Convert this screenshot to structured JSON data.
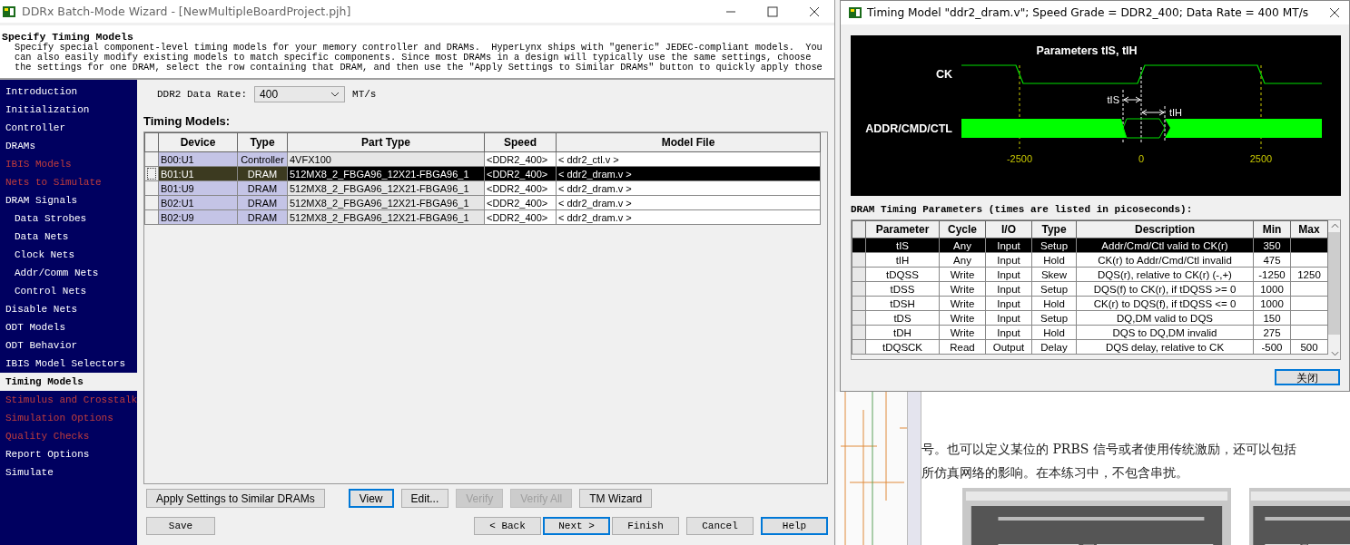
{
  "main_window": {
    "title": "DDRx Batch-Mode Wizard - [NewMultipleBoardProject.pjh]"
  },
  "header": {
    "title": "Specify Timing Models",
    "description": "Specify special component-level timing models for your memory controller and DRAMs.  HyperLynx ships with \"generic\" JEDEC-compliant models.  You can also easily modify existing models to match specific components. Since most DRAMs in a design will typically use the same settings, choose the settings for one DRAM, select the row containing that DRAM, and then use the \"Apply Settings to Similar DRAMs\" button to quickly apply those"
  },
  "sidebar": {
    "items": [
      {
        "label": "Introduction",
        "selected": false,
        "disabled": false
      },
      {
        "label": "Initialization",
        "selected": false,
        "disabled": false
      },
      {
        "label": "Controller",
        "selected": false,
        "disabled": false
      },
      {
        "label": "DRAMs",
        "selected": false,
        "disabled": false
      },
      {
        "label": "IBIS Models",
        "selected": false,
        "disabled": true
      },
      {
        "label": "Nets to Simulate",
        "selected": false,
        "disabled": true
      },
      {
        "label": "DRAM Signals",
        "selected": false,
        "disabled": false,
        "children": [
          {
            "label": "Data Strobes",
            "selected": false,
            "disabled": false
          },
          {
            "label": "Data Nets",
            "selected": false,
            "disabled": false
          },
          {
            "label": "Clock Nets",
            "selected": false,
            "disabled": false
          },
          {
            "label": "Addr/Comm Nets",
            "selected": false,
            "disabled": false
          },
          {
            "label": "Control Nets",
            "selected": false,
            "disabled": false
          }
        ]
      },
      {
        "label": "Disable Nets",
        "selected": false,
        "disabled": false
      },
      {
        "label": "ODT Models",
        "selected": false,
        "disabled": false
      },
      {
        "label": "ODT Behavior",
        "selected": false,
        "disabled": false
      },
      {
        "label": "IBIS Model Selectors",
        "selected": false,
        "disabled": false
      },
      {
        "label": "Timing Models",
        "selected": true,
        "disabled": false
      },
      {
        "label": "Stimulus and Crosstalk",
        "selected": false,
        "disabled": true
      },
      {
        "label": "Simulation Options",
        "selected": false,
        "disabled": true
      },
      {
        "label": "Quality Checks",
        "selected": false,
        "disabled": true
      },
      {
        "label": "Report Options",
        "selected": false,
        "disabled": false
      },
      {
        "label": "Simulate",
        "selected": false,
        "disabled": false
      }
    ]
  },
  "data_rate": {
    "label": "DDR2 Data Rate:",
    "value": "400",
    "unit": "MT/s"
  },
  "timing_models": {
    "heading": "Timing Models:",
    "columns": [
      "Device",
      "Type",
      "Part Type",
      "Speed",
      "Model File"
    ],
    "rows": [
      {
        "selected": false,
        "cells": [
          "B00:U1",
          "Controller",
          "4VFX100",
          "<DDR2_400>",
          "< ddr2_ctl.v >"
        ]
      },
      {
        "selected": true,
        "cells": [
          "B01:U1",
          "DRAM",
          "512MX8_2_FBGA96_12X21-FBGA96_1",
          "<DDR2_400>",
          "< ddr2_dram.v >"
        ]
      },
      {
        "selected": false,
        "cells": [
          "B01:U9",
          "DRAM",
          "512MX8_2_FBGA96_12X21-FBGA96_1",
          "<DDR2_400>",
          "< ddr2_dram.v >"
        ]
      },
      {
        "selected": false,
        "cells": [
          "B02:U1",
          "DRAM",
          "512MX8_2_FBGA96_12X21-FBGA96_1",
          "<DDR2_400>",
          "< ddr2_dram.v >"
        ]
      },
      {
        "selected": false,
        "cells": [
          "B02:U9",
          "DRAM",
          "512MX8_2_FBGA96_12X21-FBGA96_1",
          "<DDR2_400>",
          "< ddr2_dram.v >"
        ]
      }
    ]
  },
  "action_buttons": [
    {
      "label": "Apply Settings to Similar DRAMs",
      "disabled": false,
      "focused": false
    },
    {
      "label": "View",
      "disabled": false,
      "focused": true
    },
    {
      "label": "Edit...",
      "disabled": false,
      "focused": false
    },
    {
      "label": "Verify",
      "disabled": true,
      "focused": false
    },
    {
      "label": "Verify All",
      "disabled": true,
      "focused": false
    },
    {
      "label": "TM Wizard",
      "disabled": false,
      "focused": false
    }
  ],
  "nav_buttons": [
    {
      "label": "Save",
      "focused": false
    },
    {
      "label": "< Back",
      "focused": false
    },
    {
      "label": "Next >",
      "focused": true
    },
    {
      "label": "Finish",
      "focused": false
    },
    {
      "label": "Cancel",
      "focused": false
    },
    {
      "label": "Help",
      "focused": true
    }
  ],
  "dialog": {
    "title": "Timing Model \"ddr2_dram.v\";  Speed Grade = DDR2_400;  Data Rate = 400 MT/s",
    "diagram": {
      "title": "Parameters tIS, tIH",
      "signals": [
        "CK",
        "ADDR/CMD/CTL"
      ],
      "ticks": [
        "-2500",
        "0",
        "2500"
      ],
      "markers": [
        "tIS",
        "tIH"
      ]
    },
    "parameters": {
      "heading": "DRAM Timing Parameters (times are listed in picoseconds):",
      "columns": [
        "Parameter",
        "Cycle",
        "I/O",
        "Type",
        "Description",
        "Min",
        "Max"
      ],
      "rows": [
        {
          "selected": true,
          "cells": [
            "tIS",
            "Any",
            "Input",
            "Setup",
            "Addr/Cmd/Ctl valid to CK(r)",
            "350",
            ""
          ]
        },
        {
          "selected": false,
          "cells": [
            "tIH",
            "Any",
            "Input",
            "Hold",
            "CK(r) to Addr/Cmd/Ctl invalid",
            "475",
            ""
          ]
        },
        {
          "selected": false,
          "cells": [
            "tDQSS",
            "Write",
            "Input",
            "Skew",
            "DQS(r), relative to CK(r) (-,+)",
            "-1250",
            "1250"
          ]
        },
        {
          "selected": false,
          "cells": [
            "tDSS",
            "Write",
            "Input",
            "Setup",
            "DQS(f) to CK(r), if tDQSS >= 0",
            "1000",
            ""
          ]
        },
        {
          "selected": false,
          "cells": [
            "tDSH",
            "Write",
            "Input",
            "Hold",
            "CK(r) to DQS(f), if tDQSS <= 0",
            "1000",
            ""
          ]
        },
        {
          "selected": false,
          "cells": [
            "tDS",
            "Write",
            "Input",
            "Setup",
            "DQ,DM valid to DQS",
            "150",
            ""
          ]
        },
        {
          "selected": false,
          "cells": [
            "tDH",
            "Write",
            "Input",
            "Hold",
            "DQS to DQ,DM invalid",
            "275",
            ""
          ]
        },
        {
          "selected": false,
          "cells": [
            "tDQSCK",
            "Read",
            "Output",
            "Delay",
            "DQS delay, relative to CK",
            "-500",
            "500"
          ]
        }
      ]
    },
    "close_button": "关闭"
  },
  "background_document": {
    "lines": [
      "号。也可以定义某位的 PRBS 信号或者使用传统激励，还可以包括",
      "所仿真网络的影响。在本练习中，不包含串扰。"
    ],
    "figures": [
      {
        "kind": "picture"
      },
      {
        "kind": "picture"
      }
    ]
  }
}
